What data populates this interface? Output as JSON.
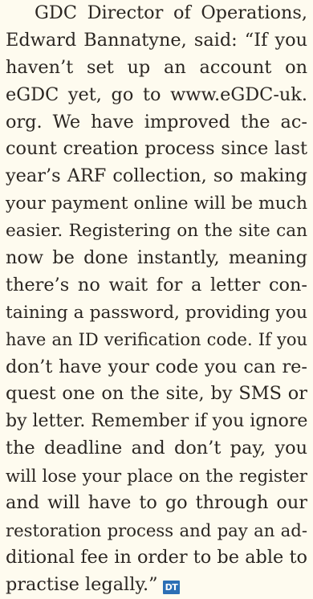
{
  "article": {
    "lines": [
      "GDC Director of Operations,",
      "Edward Bannatyne, said: “If you",
      "haven’t set up an account on",
      "eGDC yet, go to www.eGDC-uk.",
      "org. We have improved the ac-",
      "count creation process since last",
      "year’s ARF collection, so making",
      "your payment online will be much",
      "easier. Registering on the site can",
      "now be done instantly, meaning",
      "there’s no wait for a letter con-",
      "taining a password, providing you",
      "have an ID verification code. If you",
      "don’t have your code you can re-",
      "quest one on the site, by SMS or",
      "by letter. Remember if you ignore",
      "the deadline and don’t pay, you",
      "will lose your place on the register",
      "and will have to go through our",
      "restoration process and pay an ad-",
      "ditional fee in order to be able to",
      "practise legally.”"
    ],
    "end_mark": "DT"
  },
  "colors": {
    "background": "#fefbef",
    "text": "#2b2622",
    "end_mark_bg": "#2c6fb5"
  }
}
